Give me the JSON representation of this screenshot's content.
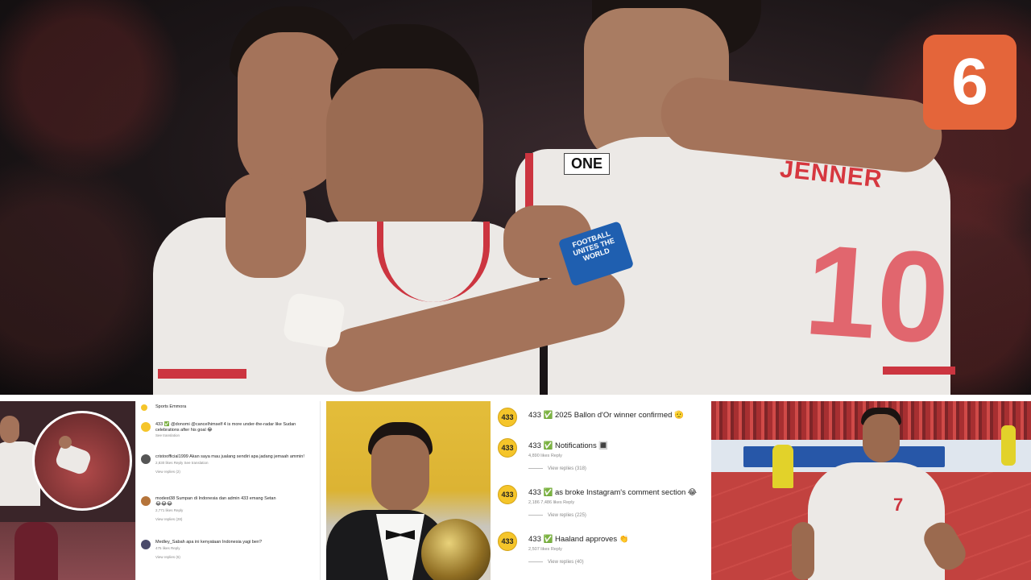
{
  "hero": {
    "jersey_name": "JENNER",
    "jersey_number": "10",
    "sponsor": "ONE"
  },
  "logo": {
    "text": "6",
    "color": "#e4653a"
  },
  "comments_b": [
    {
      "avatar": "433",
      "text": "433 ✅ 2025 Ballon d'Or winner confirmed 🫡"
    },
    {
      "avatar": "433",
      "text": "433 ✅ Notifications 🔳",
      "meta": "4,890 likes   Reply",
      "replies": "View replies (318)"
    },
    {
      "avatar": "433",
      "text": "433 ✅ as broke Instagram's comment section 😂",
      "meta": "2,186   7,486 likes   Reply",
      "replies": "View replies (225)"
    },
    {
      "avatar": "433",
      "text": "433 ✅ Haaland approves 👏",
      "meta": "2,507 likes   Reply",
      "replies": "View replies (40)"
    }
  ],
  "comments_a": [
    {
      "text": "Sports Emmora"
    },
    {
      "text": "433 ✅ @donomi @cancelhimself 4 is more under-the-radar like Sudan celebrations after his goal 😂",
      "meta": "See translation"
    },
    {
      "text": "cristoofficial1999 Akan saya mau jualang sendiri apa jadang jemaah ammin!",
      "meta": "2,830 likes   Reply   See translation",
      "replies": "View replies (2)"
    },
    {
      "text": "modest38 Sumpan di Indonesia dan admin 433 emang Setan",
      "meta": "2,771 likes   Reply",
      "replies": "View replies (28)"
    },
    {
      "text": "Medley_Sabah apa ini kenyataan Indonesia yagi ben?",
      "meta": "475 likes   Reply",
      "replies": "View replies (6)"
    }
  ]
}
